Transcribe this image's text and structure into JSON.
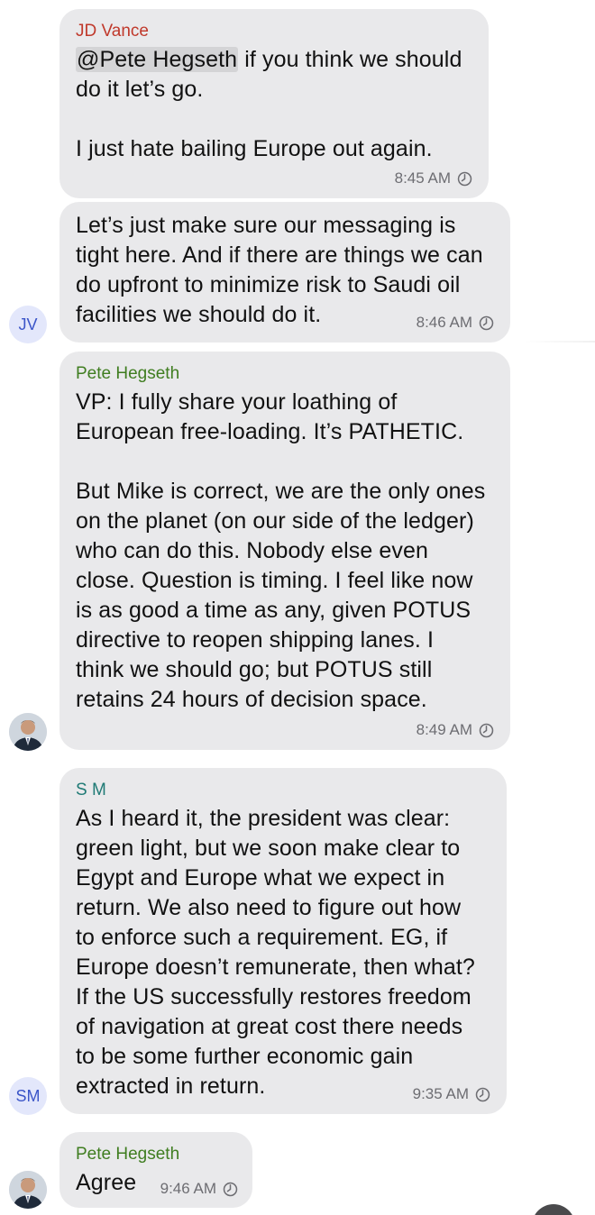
{
  "messages": [
    {
      "sender": "JD Vance",
      "mention": "@Pete Hegseth",
      "line1_rest": " if you think we should",
      "body": "do it let’s go.\n\nI just hate bailing Europe out again.",
      "time": "8:45 AM"
    },
    {
      "body": "Let’s just make sure our messaging is\ntight here. And if there are things we can\ndo upfront to minimize risk to Saudi oil\nfacilities we should do it.",
      "time": "8:46 AM",
      "avatar_initials": "JV"
    },
    {
      "sender": "Pete Hegseth",
      "body": "VP: I fully share your loathing of\nEuropean free-loading. It’s PATHETIC.\n\nBut Mike is correct, we are the only ones\non the planet (on our side of the ledger)\nwho can do this. Nobody else even\nclose. Question is timing. I feel like now\nis as good a time as any, given POTUS\ndirective to reopen shipping lanes. I\nthink we should go; but POTUS still\nretains 24 hours of decision space.",
      "time": "8:49 AM"
    },
    {
      "sender": "S M",
      "body": "As I heard it, the president was clear:\ngreen light, but we soon make clear to\nEgypt and Europe what we expect in\nreturn. We also need to figure out how\nto enforce such a requirement. EG, if\nEurope doesn’t remunerate, then what?\nIf the US successfully restores freedom\nof navigation at great cost there needs\nto be some further economic gain\nextracted in return.",
      "time": "9:35 AM",
      "avatar_initials": "SM"
    },
    {
      "sender": "Pete Hegseth",
      "body": "Agree",
      "time": "9:46 AM"
    }
  ],
  "colors": {
    "bubble": "#e9e9eb",
    "sender_jd": "#c0392b",
    "sender_pete": "#3f7d20",
    "sender_sm": "#1f7a75",
    "timestamp": "#6d6d72"
  },
  "icons": {
    "timer": "clock-timer-icon",
    "avatar_pete": "person-photo-avatar"
  }
}
